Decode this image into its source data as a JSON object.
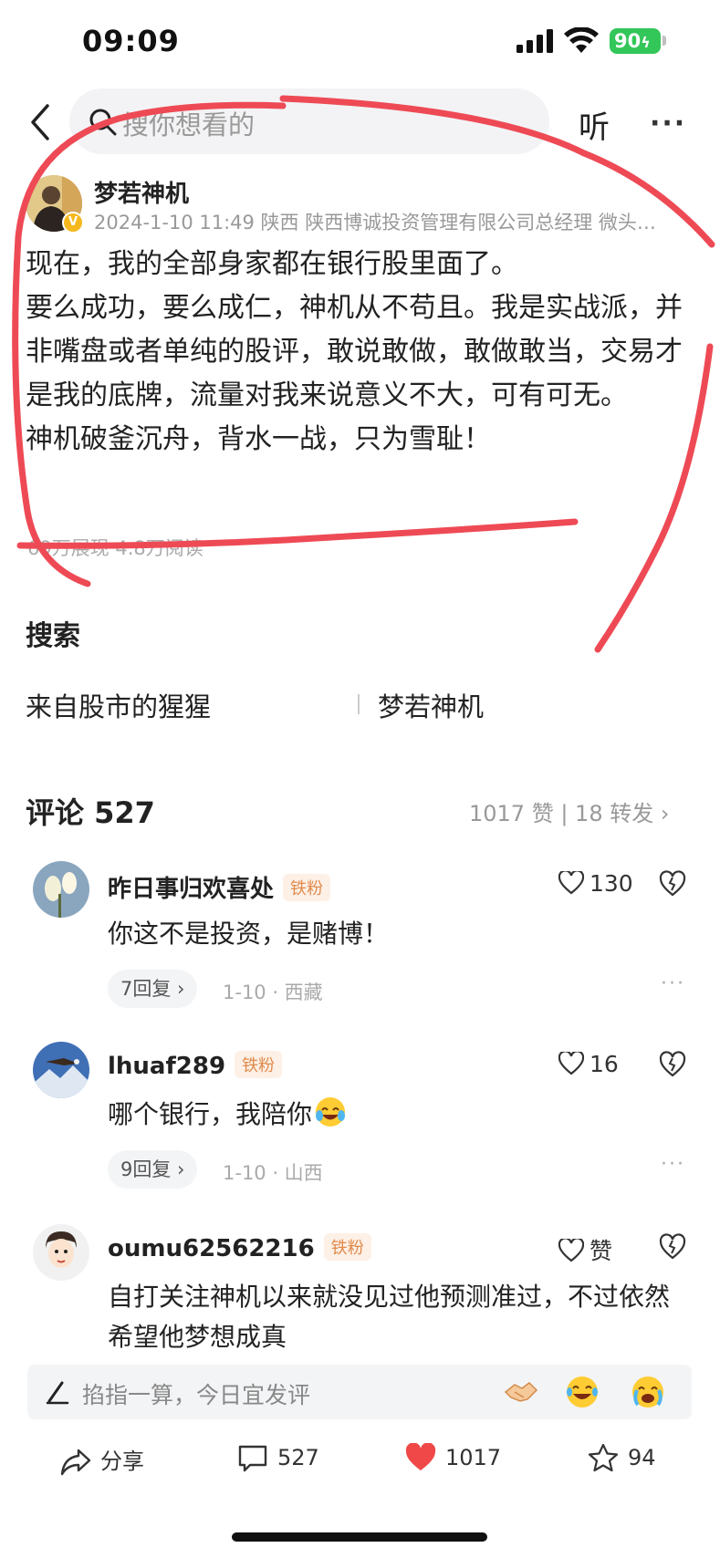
{
  "status_bar": {
    "time": "09:09",
    "battery": "90"
  },
  "nav": {
    "search_placeholder": "搜你想看的",
    "listen_label": "听",
    "more_label": "···"
  },
  "author": {
    "name": "梦若神机",
    "meta": "2024-1-10 11:49  陕西  陕西博诚投资管理有限公司总经理 微头…",
    "verified_badge": "V"
  },
  "post": {
    "paragraphs": [
      "现在，我的全部身家都在银行股里面了。",
      "要么成功，要么成仁，神机从不苟且。我是实战派，并非嘴盘或者单纯的股评，敢说敢做，敢做敢当，交易才是我的底牌，流量对我来说意义不大，可有可无。",
      "神机破釜沉舟，背水一战，只为雪耻！"
    ],
    "stats": "69万展现  4.8万阅读"
  },
  "search_section": {
    "title": "搜索",
    "tags": [
      "来自股市的猩猩",
      "梦若神机"
    ]
  },
  "comments_header": {
    "title": "评论 527",
    "stats": "1017 赞  |  18 转发  ›"
  },
  "comments": [
    {
      "user": "昨日事归欢喜处",
      "badge": "铁粉",
      "likes": "130",
      "text": "你这不是投资，是赌博！",
      "replies": "7回复 ›",
      "meta": "1-10 · 西藏"
    },
    {
      "user": "lhuaf289",
      "badge": "铁粉",
      "likes": "16",
      "text": "哪个银行，我陪你",
      "replies": "9回复 ›",
      "meta": "1-10 · 山西"
    },
    {
      "user": "oumu62562216",
      "badge": "铁粉",
      "likes": "赞",
      "text": "自打关注神机以来就没见过他预测准过，不过依然希望他梦想成真"
    }
  ],
  "input_bar": {
    "placeholder": "掐指一算，今日宜发评"
  },
  "actions": {
    "share": "分享",
    "comment": "527",
    "like": "1017",
    "favorite": "94"
  },
  "colors": {
    "accent_red": "#f04848",
    "battery_green": "#33c659",
    "badge_orange": "#e08a4c",
    "scribble_red": "#ee4a55"
  }
}
